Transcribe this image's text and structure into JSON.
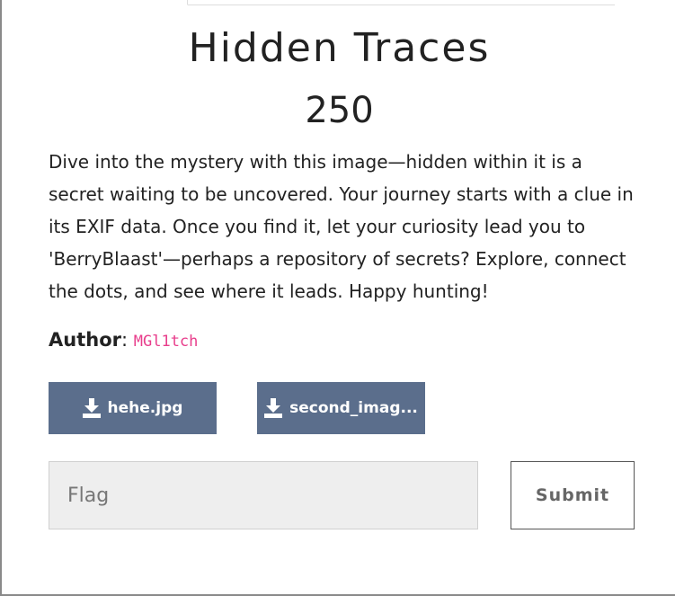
{
  "challenge": {
    "title": "Hidden Traces",
    "points": "250",
    "description": "Dive into the mystery with this image—hidden within it is a secret waiting to be uncovered. Your journey starts with a clue in its EXIF data. Once you find it, let your curiosity lead you to 'BerryBlaast'—perhaps a repository of secrets? Explore, connect the dots, and see where it leads. Happy hunting!",
    "author_label": "Author",
    "author_separator": ": ",
    "author_name": "MGl1tch"
  },
  "files": [
    {
      "label": "hehe.jpg",
      "icon": "download-icon"
    },
    {
      "label": "second_imag...",
      "icon": "download-icon"
    }
  ],
  "flag_form": {
    "placeholder": "Flag",
    "value": "",
    "submit_label": "Submit"
  }
}
